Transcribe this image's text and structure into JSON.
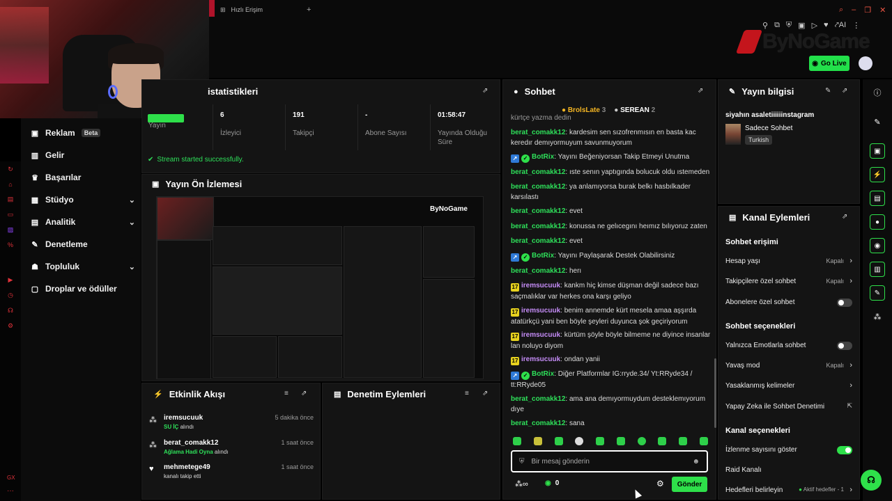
{
  "browser": {
    "tab_label": "Hızlı Erişim",
    "new_tab": "+"
  },
  "header": {
    "logo_text": "ByNoGame",
    "go_live": "Go Live",
    "ai_label": "AI"
  },
  "nav": {
    "items": [
      {
        "label": "Reklam",
        "badge": "Beta"
      },
      {
        "label": "Gelir"
      },
      {
        "label": "Başarılar"
      },
      {
        "label": "Stüdyo"
      },
      {
        "label": "Analitik"
      },
      {
        "label": "Denetleme"
      },
      {
        "label": "Topluluk"
      },
      {
        "label": "Droplar ve ödüller"
      }
    ]
  },
  "stats": {
    "title": "istatistikleri",
    "cells": [
      {
        "value": "",
        "label": "Yayın"
      },
      {
        "value": "6",
        "label": "İzleyici"
      },
      {
        "value": "191",
        "label": "Takipçi"
      },
      {
        "value": "-",
        "label": "Abone Sayısı"
      },
      {
        "value": "01:58:47",
        "label": "Yayında Olduğu Süre"
      }
    ],
    "success": "Stream started successfully."
  },
  "preview": {
    "title": "Yayın Ön İzlemesi",
    "overlay_logo": "ByNoGame"
  },
  "activity": {
    "title": "Etkinlik Akışı",
    "items": [
      {
        "name": "iremsucuuk",
        "time": "5 dakika önce",
        "highlight": "SU İÇ",
        "suffix": "alındı"
      },
      {
        "name": "berat_comakk12",
        "time": "1 saat önce",
        "highlight": "Ağlama Hadi Oyna",
        "suffix": "alındı"
      },
      {
        "name": "mehmetege49",
        "time": "1 saat önce",
        "highlight": "",
        "suffix": "kanalı takip etti"
      }
    ]
  },
  "moderation": {
    "title": "Denetim Eylemleri"
  },
  "chat": {
    "title": "Sohbet",
    "top": [
      {
        "name": "BrolsLate",
        "count": "3"
      },
      {
        "name": "SEREAN",
        "count": "2"
      }
    ],
    "messages": [
      {
        "user": "",
        "text": "kürtçe yazma dedin"
      },
      {
        "user": "berat_comakk12",
        "text": "kardesim sen sızofrenmısın en basta kac keredır demıyormuyum savunmuyorum"
      },
      {
        "user": "BotRix",
        "text": "Yayını Beğeniyorsan Takip Etmeyi Unutma"
      },
      {
        "user": "berat_comakk12",
        "text": "ıste senın yaptıgında bolucuk oldu ıstemeden"
      },
      {
        "user": "berat_comakk12",
        "text": "ya anlamıyorsa burak belkı hasbılkader karsılastı"
      },
      {
        "user": "berat_comakk12",
        "text": "evet"
      },
      {
        "user": "berat_comakk12",
        "text": "konussa ne gelıcegını heımız bılıyoruz zaten"
      },
      {
        "user": "berat_comakk12",
        "text": "evet"
      },
      {
        "user": "BotRix",
        "text": "Yayını Paylaşarak Destek Olabilirsiniz"
      },
      {
        "user": "berat_comakk12",
        "text": "herı"
      },
      {
        "user": "iremsucuuk",
        "text": "kankm hiç kimse düşman değil sadece bazı saçmalıklar var herkes ona karşı geliyo"
      },
      {
        "user": "iremsucuuk",
        "text": "benim annemde kürt mesela amaa aşşırda atatürkçü yani ben böyle şeyleri duyunca şok geçiriyorum"
      },
      {
        "user": "iremsucuuk",
        "text": "kürtüm şöyle böyle bilmeme ne diyince insanlar lan noluyo diyom"
      },
      {
        "user": "iremsucuuk",
        "text": "ondan yanii"
      },
      {
        "user": "BotRix",
        "text": "Diğer Platformlar IG:rryde.34/ Yt:RRyde34 / tt:RRyde05"
      },
      {
        "user": "berat_comakk12",
        "text": "ama ana demıyormuydum desteklemıyorum dıye"
      },
      {
        "user": "berat_comakk12",
        "text": "sana"
      }
    ],
    "badge_num": "17",
    "input_placeholder": "Bir mesaj gönderin",
    "points": "0",
    "send": "Gönder"
  },
  "info": {
    "title": "Yayın bilgisi",
    "stream_title": "siyahın asaletiiiiiinstagram",
    "category": "Sadece Sohbet",
    "language": "Turkish"
  },
  "actions": {
    "title": "Kanal Eylemleri",
    "chat_access": "Sohbet erişimi",
    "account_age": "Hesap yaşı",
    "account_age_val": "Kapalı",
    "followers_only": "Takipçilere özel sohbet",
    "followers_only_val": "Kapalı",
    "subs_only": "Abonelere özel sohbet",
    "chat_options": "Sohbet seçenekleri",
    "emotes_only": "Yalnızca Emotlarla sohbet",
    "slow_mode": "Yavaş mod",
    "slow_mode_val": "Kapalı",
    "banned_words": "Yasaklanmış kelimeler",
    "ai_mod": "Yapay Zeka ile Sohbet Denetimi",
    "channel_options": "Kanal seçenekleri",
    "show_viewers": "İzlenme sayısını göster",
    "raid": "Raid Kanalı",
    "goals": "Hedefleri belirleyin",
    "goals_val": "Aktif hedefler - 1"
  },
  "colors": {
    "accent": "#2ee04a",
    "brand": "#c4151c",
    "panel": "#141414"
  }
}
